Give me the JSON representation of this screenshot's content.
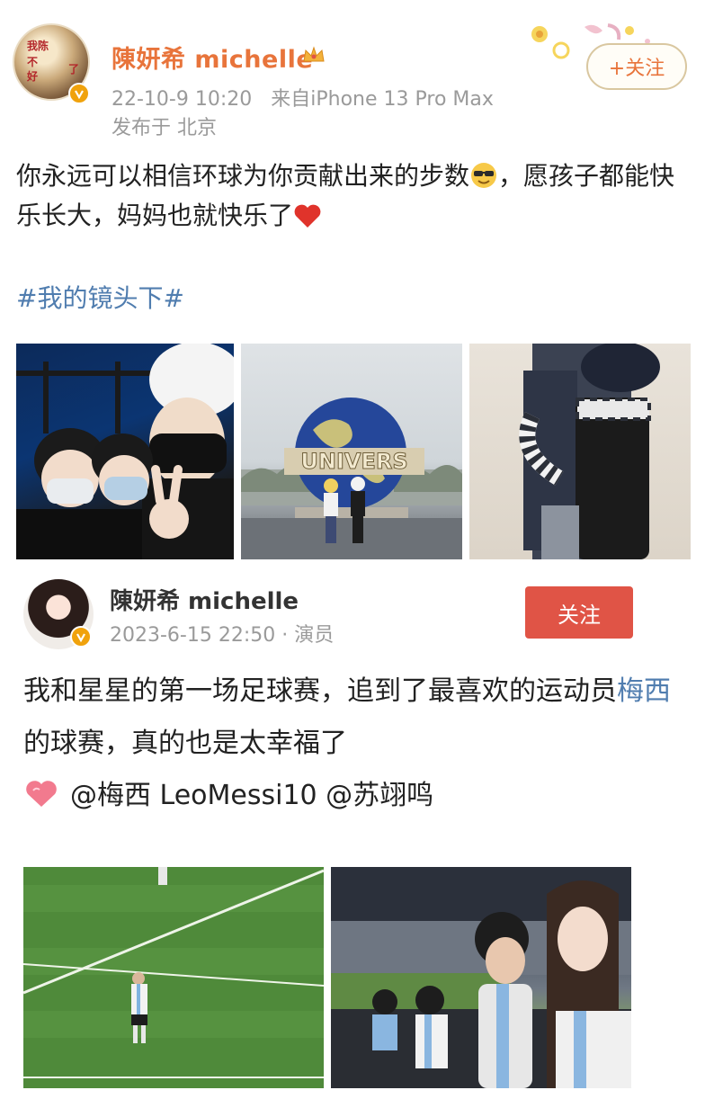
{
  "post1": {
    "avatar_text": [
      "我陈",
      "不",
      "好",
      "了"
    ],
    "username": "陳妍希 michelle",
    "timestamp": "22-10-9 10:20",
    "source": "来自iPhone 13 Pro Max",
    "location": "发布于 北京",
    "follow_label": "+关注",
    "text_part1": "你永远可以相信环球为你贡献出来的步数",
    "text_part2": "，愿孩子都能快乐长大，妈妈也就快乐了",
    "hashtag": "#我的镜头下#",
    "photo2_sign": "UNIVERS"
  },
  "post2": {
    "username": "陳妍希 michelle",
    "timestamp": "2023-6-15 22:50",
    "separator": " · ",
    "role": "演员",
    "follow_label": "关注",
    "text_part1": "我和星星的第一场足球赛，追到了最喜欢的运动员",
    "text_link": "梅西",
    "text_part2": "的球赛，真的也是太幸福了",
    "mentions": "@梅西 LeoMessi10 @苏翊鸣"
  },
  "colors": {
    "accent_orange": "#e8743b",
    "link_blue": "#507daf",
    "follow_red": "#e05446",
    "meta_gray": "#9a9a9a"
  }
}
